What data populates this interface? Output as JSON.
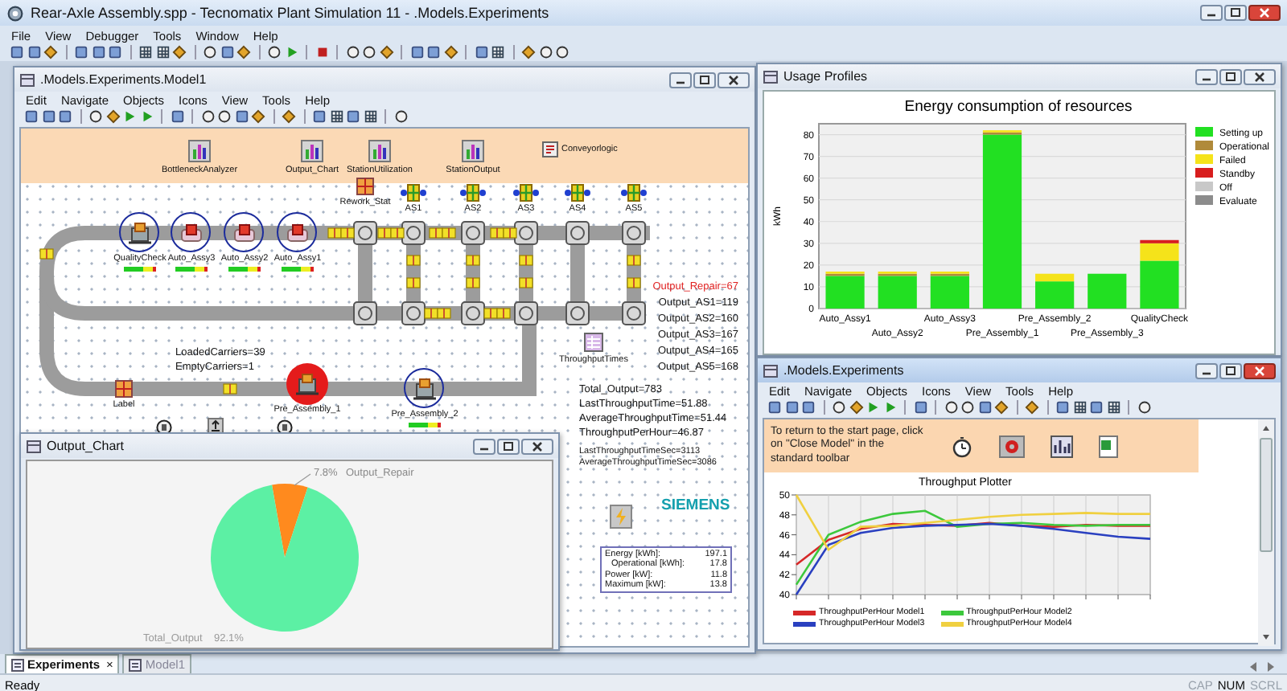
{
  "window": {
    "title": "Rear-Axle Assembly.spp - Tecnomatix Plant Simulation 11 - .Models.Experiments"
  },
  "menu": [
    "File",
    "View",
    "Debugger",
    "Tools",
    "Window",
    "Help"
  ],
  "model_window": {
    "title": ".Models.Experiments.Model1",
    "active": false,
    "menu": [
      "Edit",
      "Navigate",
      "Objects",
      "Icons",
      "View",
      "Tools",
      "Help"
    ],
    "header_objects": [
      {
        "label": "BottleneckAnalyzer",
        "kind": "chart"
      },
      {
        "label": "Output_Chart",
        "kind": "chart"
      },
      {
        "label": "StationUtilization",
        "kind": "chart"
      },
      {
        "label": "StationOutput",
        "kind": "chart"
      },
      {
        "label": "Conveyorlogic",
        "kind": "method"
      }
    ],
    "stations": [
      {
        "label": "QualityCheck",
        "kind": "machine",
        "busy": true,
        "failed": false
      },
      {
        "label": "Auto_Assy3",
        "kind": "robot",
        "busy": true,
        "failed": false
      },
      {
        "label": "Auto_Assy2",
        "kind": "robot",
        "busy": true,
        "failed": false
      },
      {
        "label": "Auto_Assy1",
        "kind": "robot",
        "busy": true,
        "failed": false
      },
      {
        "label": "Rework_Stat",
        "kind": "box",
        "busy": false,
        "failed": false
      },
      {
        "label": "AS1",
        "kind": "cross",
        "busy": false,
        "failed": false
      },
      {
        "label": "AS2",
        "kind": "cross",
        "busy": false,
        "failed": false
      },
      {
        "label": "AS3",
        "kind": "cross",
        "busy": false,
        "failed": false
      },
      {
        "label": "AS4",
        "kind": "cross",
        "busy": false,
        "failed": false
      },
      {
        "label": "AS5",
        "kind": "cross",
        "busy": false,
        "failed": false
      },
      {
        "label": "Label",
        "kind": "box",
        "busy": false,
        "failed": false
      },
      {
        "label": "Pre_Assembly_1",
        "kind": "machine",
        "busy": false,
        "failed": true
      },
      {
        "label": "Pre_Assembly_2",
        "kind": "machine",
        "busy": true,
        "failed": false
      }
    ],
    "counters": [
      "LoadedCarriers=39",
      "EmptyCarriers=1"
    ],
    "outputs": [
      {
        "text": "Output_Repair=67",
        "alert": true
      },
      {
        "text": "Output_AS1=119",
        "alert": false
      },
      {
        "text": "Output_AS2=160",
        "alert": false
      },
      {
        "text": "Output_AS3=167",
        "alert": false
      },
      {
        "text": "Output_AS4=165",
        "alert": false
      },
      {
        "text": "Output_AS5=168",
        "alert": false
      }
    ],
    "throughput_times_label": "ThroughputTimes",
    "statistics": [
      "Total_Output=783",
      "LastThroughputTime=51.88",
      "AverageThroughputTime=51.44",
      "ThroughputPerHour=46.87"
    ],
    "statistics_sec": [
      "LastThroughputTimeSec=3113",
      "AverageThroughputTimeSec=3086"
    ],
    "logo": "SIEMENS",
    "energy": [
      {
        "label": "Energy [kWh]:",
        "value": "197.1",
        "children": [
          {
            "label": "Operational [kWh]:",
            "value": "17.8"
          }
        ]
      },
      {
        "label": "Power [kW]:",
        "value": "11.8"
      },
      {
        "label": "Maximum [kW]:",
        "value": "13.8"
      }
    ]
  },
  "usage_window": {
    "title": "Usage Profiles",
    "active": false,
    "chart_data": {
      "type": "bar",
      "stacked": true,
      "grid": true,
      "legend": true,
      "title": "Energy consumption of resources",
      "ylabel": "kWh",
      "ylim": [
        0,
        85
      ],
      "yticks": [
        0,
        10,
        20,
        30,
        40,
        50,
        60,
        70,
        80
      ],
      "categories": [
        "Auto_Assy1",
        "Auto_Assy2",
        "Auto_Assy3",
        "Pre_Assembly_1",
        "Pre_Assembly_2",
        "Pre_Assembly_3",
        "QualityCheck"
      ],
      "series": [
        {
          "name": "Setting up",
          "color": "#22e022",
          "values": [
            15,
            15,
            15,
            80,
            12.5,
            16,
            22
          ]
        },
        {
          "name": "Operational",
          "color": "#b08a3a",
          "values": [
            1,
            1,
            1,
            1,
            0,
            0,
            0
          ]
        },
        {
          "name": "Failed",
          "color": "#f5e31a",
          "values": [
            1,
            1,
            1,
            1,
            3.5,
            0,
            8
          ]
        },
        {
          "name": "Standby",
          "color": "#d81e1e",
          "values": [
            0,
            0,
            0,
            0,
            0,
            0,
            1.5
          ]
        },
        {
          "name": "Off",
          "color": "#c8c8c8",
          "values": [
            0,
            0,
            0,
            0,
            0,
            0,
            0
          ]
        },
        {
          "name": "Evaluate",
          "color": "#8c8c8c",
          "values": [
            0,
            0,
            0,
            0,
            0,
            0,
            0
          ]
        }
      ]
    }
  },
  "experiments_window": {
    "title": ".Models.Experiments",
    "active": true,
    "menu": [
      "Edit",
      "Navigate",
      "Objects",
      "Icons",
      "View",
      "Tools",
      "Help"
    ],
    "note": "To return to the start page, click on \"Close Model\" in the standard toolbar",
    "plotter": {
      "chart_data": {
        "type": "line",
        "title": "Throughput Plotter",
        "ylim": [
          40,
          50
        ],
        "yticks": [
          40,
          42,
          44,
          46,
          48,
          50
        ],
        "grid": true,
        "legend": true,
        "series": [
          {
            "name": "ThroughputPerHour Model1",
            "color": "#d62828",
            "values": [
              43,
              45.5,
              46.6,
              47.1,
              47,
              46.9,
              47.2,
              46.9,
              46.8,
              47,
              46.9,
              46.9
            ]
          },
          {
            "name": "ThroughputPerHour Model2",
            "color": "#3cc83c",
            "values": [
              41,
              46,
              47.3,
              48.1,
              48.4,
              46.8,
              47.1,
              47.2,
              47,
              46.9,
              47,
              47
            ]
          },
          {
            "name": "ThroughputPerHour Model3",
            "color": "#2a40c0",
            "values": [
              40,
              45,
              46.2,
              46.7,
              46.9,
              47,
              47.1,
              46.9,
              46.6,
              46.2,
              45.8,
              45.6
            ]
          },
          {
            "name": "ThroughputPerHour Model4",
            "color": "#f0d040",
            "values": [
              50,
              44.5,
              46.8,
              46.9,
              47.2,
              47.5,
              47.8,
              48,
              48.1,
              48.2,
              48.1,
              48.1
            ]
          }
        ]
      }
    }
  },
  "output_window": {
    "title": "Output_Chart",
    "active": false,
    "chart_data": {
      "type": "pie",
      "categories": [
        "Output_Repair",
        "Total_Output"
      ],
      "values": [
        7.8,
        92.1
      ],
      "value_labels": [
        "7.8%",
        "92.1%"
      ]
    }
  },
  "tabs": [
    {
      "label": "Experiments",
      "selected": true,
      "close": "×"
    },
    {
      "label": "Model1",
      "selected": false
    }
  ],
  "status_bar": {
    "text": "Ready",
    "indicators": [
      {
        "label": "CAP",
        "on": false
      },
      {
        "label": "NUM",
        "on": true
      },
      {
        "label": "SCRL",
        "on": false
      }
    ]
  }
}
